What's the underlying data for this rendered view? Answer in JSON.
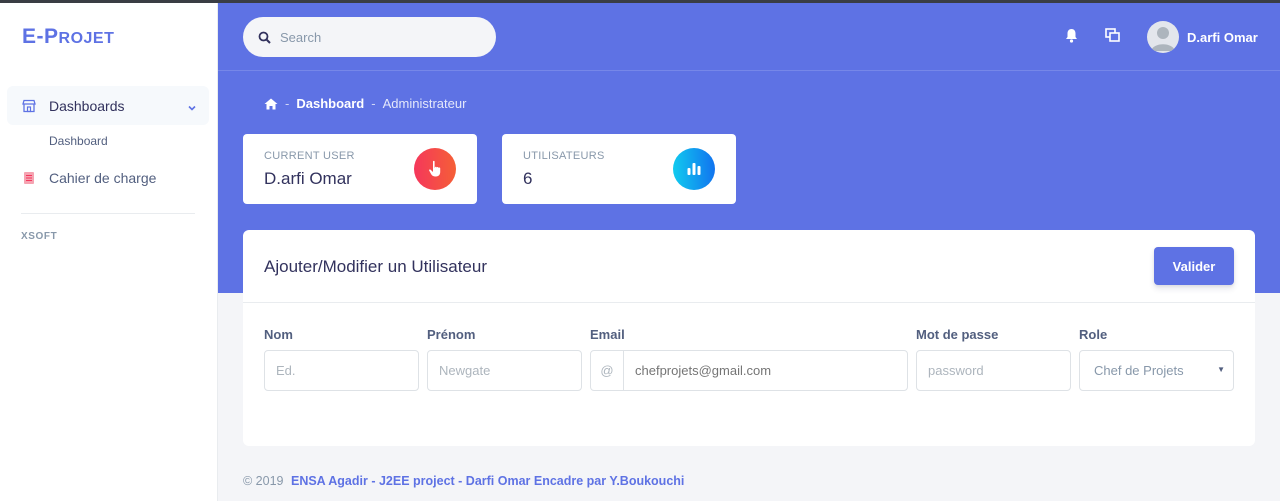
{
  "brand": {
    "first": "E-",
    "rest_initial": "P",
    "rest": "ROJET"
  },
  "sidebar": {
    "items": [
      {
        "label": "Dashboards",
        "icon": "storefront-icon",
        "active": true
      },
      {
        "label": "Dashboard",
        "sub": true
      },
      {
        "label": "Cahier de charge",
        "icon": "document-icon"
      }
    ],
    "heading": "XSOFT"
  },
  "header": {
    "search_placeholder": "Search",
    "user_name": "D.arfi Omar",
    "icons": [
      "bell-icon",
      "window-icon",
      "avatar"
    ]
  },
  "breadcrumb": {
    "home_icon": "home-icon",
    "items": [
      "Dashboard",
      "Administrateur"
    ],
    "separator": "-"
  },
  "stats": [
    {
      "title": "CURRENT USER",
      "value": "D.arfi Omar",
      "icon": "hand-pointer-icon",
      "color": "#f5365c"
    },
    {
      "title": "UTILISATEURS",
      "value": "6",
      "icon": "bar-chart-icon",
      "color": "#11cdef"
    }
  ],
  "form": {
    "title": "Ajouter/Modifier un Utilisateur",
    "submit_label": "Valider",
    "fields": {
      "nom": {
        "label": "Nom",
        "placeholder": "Ed."
      },
      "prenom": {
        "label": "Prénom",
        "placeholder": "Newgate"
      },
      "email": {
        "label": "Email",
        "prefix": "@",
        "placeholder": "chefprojets@gmail.com"
      },
      "password": {
        "label": "Mot de passe",
        "placeholder": "password"
      },
      "role": {
        "label": "Role",
        "value": "Chef de Projets"
      }
    }
  },
  "footer": {
    "copyright": "© 2019",
    "link": "ENSA Agadir - J2EE project - Darfi Omar Encadre par Y.Boukouchi"
  },
  "colors": {
    "primary": "#5e72e4",
    "background": "#f4f5f8",
    "text": "#32325d"
  }
}
